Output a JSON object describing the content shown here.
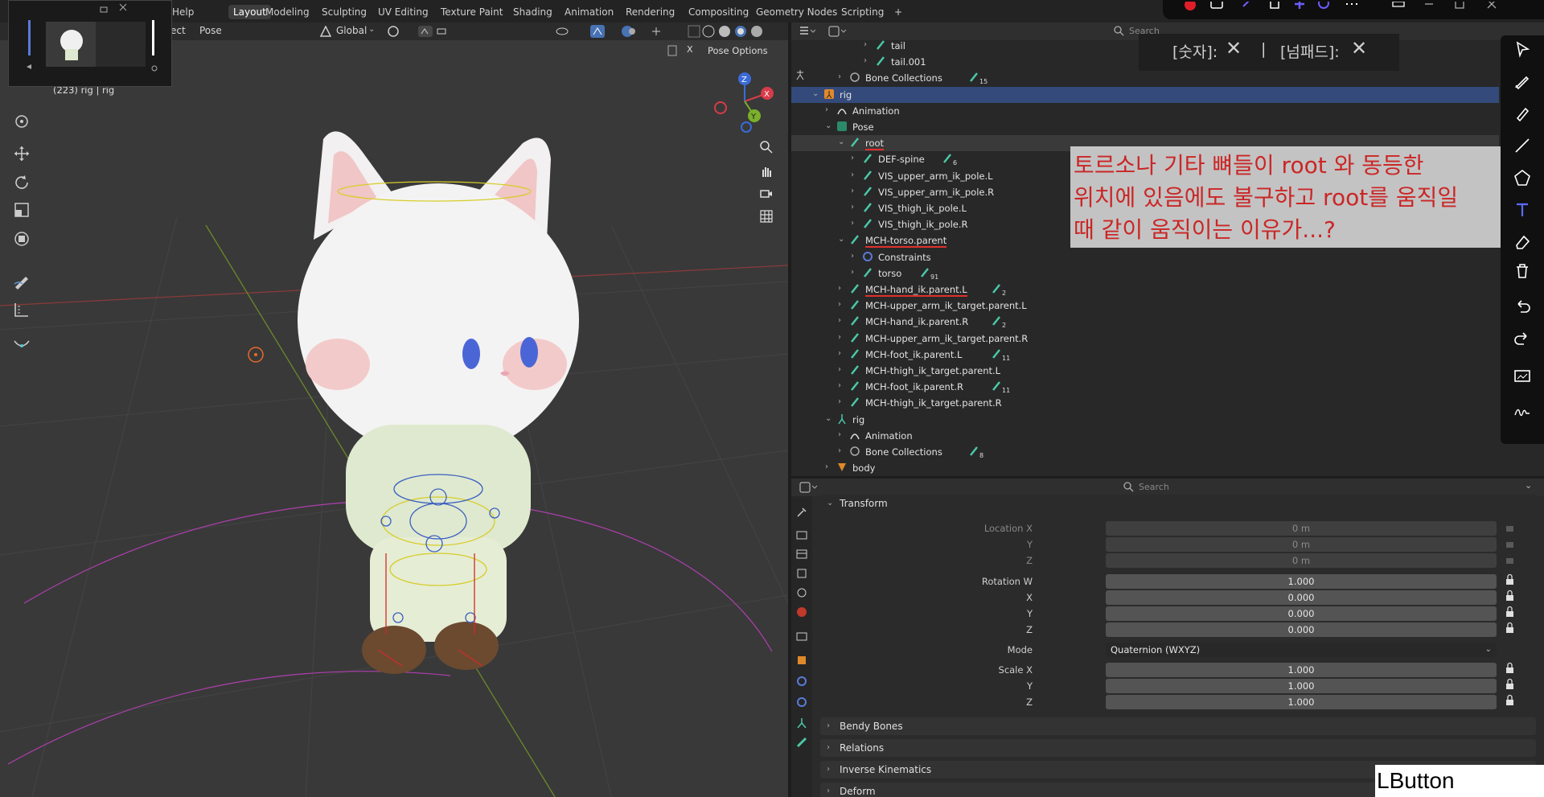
{
  "topbar": {
    "menu_help": "Help",
    "workspaces": [
      "Layout",
      "Modeling",
      "Sculpting",
      "UV Editing",
      "Texture Paint",
      "Shading",
      "Animation",
      "Rendering",
      "Compositing",
      "Geometry Nodes",
      "Scripting"
    ],
    "add_tab": "+"
  },
  "viewport": {
    "menu_select": "ect",
    "menu_pose": "Pose",
    "orientation": "Global",
    "pose_options": "Pose Options",
    "x_toggle": "X",
    "info_text": "(223) rig | rig",
    "gizmo_axes": {
      "x": "X",
      "y": "Y",
      "z": "Z"
    }
  },
  "outliner": {
    "search_placeholder": "Search",
    "rows": [
      {
        "label": "tail",
        "depth": 6
      },
      {
        "label": "tail.001",
        "depth": 6
      },
      {
        "label": "Bone Collections",
        "depth": 4,
        "badge": "15"
      },
      {
        "label": "rig",
        "depth": 2
      },
      {
        "label": "Animation",
        "depth": 3
      },
      {
        "label": "Pose",
        "depth": 3
      },
      {
        "label": "root",
        "depth": 4
      },
      {
        "label": "DEF-spine",
        "depth": 5,
        "badge": "6"
      },
      {
        "label": "VIS_upper_arm_ik_pole.L",
        "depth": 5
      },
      {
        "label": "VIS_upper_arm_ik_pole.R",
        "depth": 5
      },
      {
        "label": "VIS_thigh_ik_pole.L",
        "depth": 5
      },
      {
        "label": "VIS_thigh_ik_pole.R",
        "depth": 5
      },
      {
        "label": "MCH-torso.parent",
        "depth": 4
      },
      {
        "label": "Constraints",
        "depth": 5
      },
      {
        "label": "torso",
        "depth": 5,
        "badge": "91"
      },
      {
        "label": "MCH-hand_ik.parent.L",
        "depth": 4,
        "badge": "2"
      },
      {
        "label": "MCH-upper_arm_ik_target.parent.L",
        "depth": 4
      },
      {
        "label": "MCH-hand_ik.parent.R",
        "depth": 4,
        "badge": "2"
      },
      {
        "label": "MCH-upper_arm_ik_target.parent.R",
        "depth": 4
      },
      {
        "label": "MCH-foot_ik.parent.L",
        "depth": 4,
        "badge": "11"
      },
      {
        "label": "MCH-thigh_ik_target.parent.L",
        "depth": 4
      },
      {
        "label": "MCH-foot_ik.parent.R",
        "depth": 4,
        "badge": "11"
      },
      {
        "label": "MCH-thigh_ik_target.parent.R",
        "depth": 4
      },
      {
        "label": "rig",
        "depth": 3
      },
      {
        "label": "Animation",
        "depth": 4
      },
      {
        "label": "Bone Collections",
        "depth": 4,
        "badge": "8"
      },
      {
        "label": "body",
        "depth": 3
      }
    ]
  },
  "annotation": {
    "line1": "토르소나 기타 뼈들이 root 와 동등한",
    "line2": "위치에 있음에도 불구하고 root를 움직일",
    "line3": "때 같이 움직이는 이유가...?"
  },
  "overlay_keys": {
    "numkey": "[숫자]:",
    "numpad": "[넘패드]:",
    "separator": "|",
    "x1": "✕",
    "x2": "✕"
  },
  "properties": {
    "search_placeholder": "Search",
    "transform_title": "Transform",
    "location": {
      "label_x": "Location X",
      "label_y": "Y",
      "label_z": "Z",
      "x": "0 m",
      "y": "0 m",
      "z": "0 m"
    },
    "rotation": {
      "label_w": "Rotation W",
      "label_x": "X",
      "label_y": "Y",
      "label_z": "Z",
      "w": "1.000",
      "x": "0.000",
      "y": "0.000",
      "z": "0.000"
    },
    "mode_label": "Mode",
    "mode_value": "Quaternion (WXYZ)",
    "scale": {
      "label_x": "Scale X",
      "label_y": "Y",
      "label_z": "Z",
      "x": "1.000",
      "y": "1.000",
      "z": "1.000"
    },
    "panels": [
      "Bendy Bones",
      "Relations",
      "Inverse Kinematics",
      "Deform"
    ]
  },
  "status": {
    "lbutton": "LButton"
  },
  "colors": {
    "accent": "#4772b3",
    "annotation_text": "#d82626",
    "selected_row": "#334a7a"
  }
}
